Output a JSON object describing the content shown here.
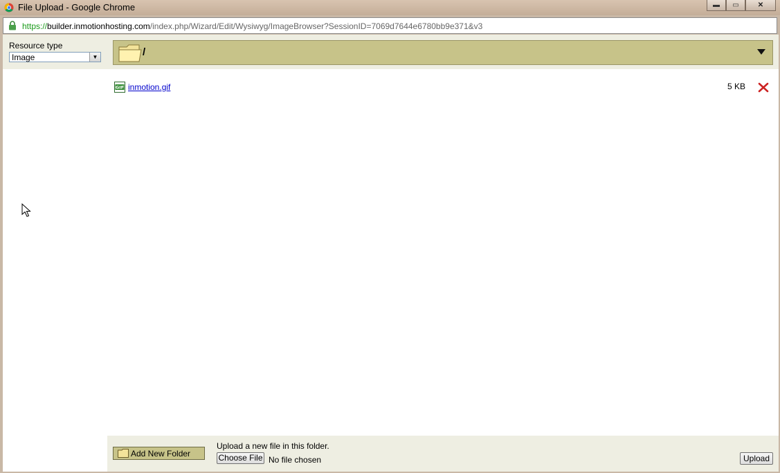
{
  "window": {
    "title": "File Upload - Google Chrome",
    "minimize_label": "▬",
    "maximize_label": "▭",
    "close_label": "✕"
  },
  "address_bar": {
    "scheme": "https://",
    "host": "builder.inmotionhosting.com",
    "path": "/index.php/Wizard/Edit/Wysiwyg/ImageBrowser?SessionID=7069d7644e6780bb9e371&v3"
  },
  "resource_type": {
    "label": "Resource type",
    "selected": "Image"
  },
  "folder_path": {
    "current": "/"
  },
  "files": [
    {
      "name": "inmotion.gif",
      "size": "5 KB",
      "icon": "gif-file-icon"
    }
  ],
  "footer": {
    "add_folder_label": "Add New Folder",
    "upload_hint": "Upload a new file in this folder.",
    "choose_file_label": "Choose File",
    "no_file_text": "No file chosen",
    "upload_label": "Upload"
  },
  "colors": {
    "toolbar_olive": "#c7c389",
    "panel_bg": "#eeeee2",
    "link_blue": "#0000cc",
    "delete_red": "#cc2222",
    "https_green": "#1a9a1a"
  }
}
